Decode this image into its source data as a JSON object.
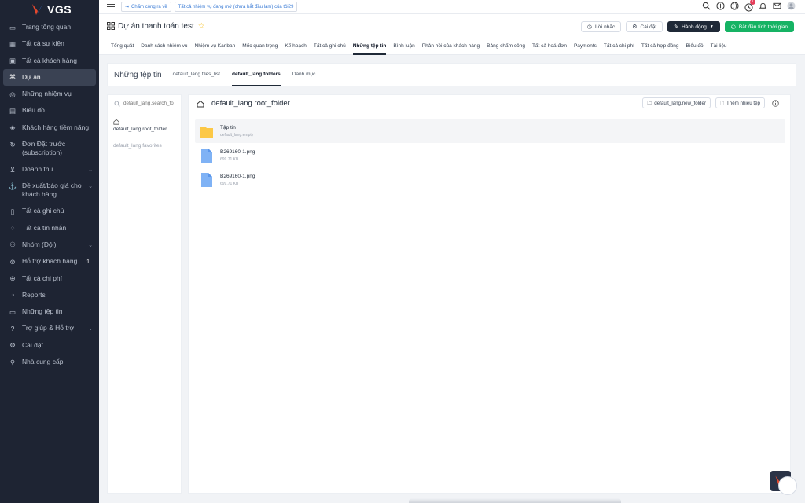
{
  "brand": {
    "logo_text": "VGS"
  },
  "sidebar": {
    "items": [
      {
        "label": "Trang tổng quan",
        "icon": "monitor-icon"
      },
      {
        "label": "Tất cả sự kiện",
        "icon": "calendar-icon"
      },
      {
        "label": "Tất cả khách hàng",
        "icon": "briefcase-icon"
      },
      {
        "label": "Dự án",
        "icon": "command-icon",
        "active": true
      },
      {
        "label": "Những nhiệm vụ",
        "icon": "check-circle-icon"
      },
      {
        "label": "Biểu đồ",
        "icon": "chart-icon"
      },
      {
        "label": "Khách hàng tiềm năng",
        "icon": "layers-icon"
      },
      {
        "label": "Đơn Đặt trước (subscription)",
        "icon": "repeat-icon"
      },
      {
        "label": "Doanh thu",
        "icon": "cart-icon",
        "chevron": true
      },
      {
        "label": "Đề xuất/báo giá cho khách hàng",
        "icon": "anchor-icon",
        "chevron": true
      },
      {
        "label": "Tất cả ghi chú",
        "icon": "book-icon"
      },
      {
        "label": "Tất cả tin nhắn",
        "icon": "message-icon"
      },
      {
        "label": "Nhóm (Đội)",
        "icon": "users-icon",
        "chevron": true
      },
      {
        "label": "Hỗ trợ khách hàng",
        "icon": "lifebuoy-icon",
        "badge": "1"
      },
      {
        "label": "Tất cả chi phí",
        "icon": "plus-circle-icon"
      },
      {
        "label": "Reports",
        "icon": "pie-icon"
      },
      {
        "label": "Những tệp tin",
        "icon": "folder-icon"
      },
      {
        "label": "Trợ giúp & Hỗ trợ",
        "icon": "help-icon",
        "chevron": true
      },
      {
        "label": "Cài đặt",
        "icon": "settings-icon"
      },
      {
        "label": "Nhà cung cấp",
        "icon": "user-icon"
      }
    ]
  },
  "topbar": {
    "clock_chip": "Chấm công ra về",
    "task_chip": "Tất cả nhiệm vụ đang mở (chưa bắt đầu làm) của tôi29",
    "notification_badge": "1"
  },
  "project": {
    "title": "Dự án thanh toán test",
    "actions": {
      "reminder": "Lời nhắc",
      "settings": "Cài đặt",
      "action": "Hành động",
      "timer": "Bắt đầu tính thời gian"
    }
  },
  "tabs": [
    "Tổng quát",
    "Danh sách nhiệm vụ",
    "Nhiệm vụ Kanban",
    "Mốc quan trọng",
    "Kế hoạch",
    "Tất cả ghi chú",
    "Những tệp tin",
    "Bình luận",
    "Phản hồi của khách hàng",
    "Bảng chấm công",
    "Tất cả hoá đơn",
    "Payments",
    "Tất cả chi phí",
    "Tất cả hợp đồng",
    "Biểu đồ",
    "Tài liệu"
  ],
  "active_tab": "Những tệp tin",
  "files": {
    "title": "Những tệp tin",
    "subtabs": [
      "default_lang.files_list",
      "default_lang.folders",
      "Danh mục"
    ],
    "active_subtab": "default_lang.folders",
    "search_placeholder": "default_lang.search_fo",
    "left": {
      "root_folder": "default_lang.root_folder",
      "favorites": "default_lang.favorites"
    },
    "main": {
      "title": "default_lang.root_folder",
      "new_folder": "default_lang.new_folder",
      "upload": "Thêm nhiều tệp"
    },
    "rows": [
      {
        "name": "Tập tin",
        "sub": "default_lang.empty",
        "type": "folder"
      },
      {
        "name": "B269160-1.png",
        "sub": "699.71 KB",
        "type": "file"
      },
      {
        "name": "B269160-1.png",
        "sub": "699.71 KB",
        "type": "file"
      }
    ]
  },
  "colors": {
    "sidebar_bg": "#1e2433",
    "accent_green": "#16b364",
    "folder": "#fcc846",
    "file": "#7fb2f5"
  }
}
